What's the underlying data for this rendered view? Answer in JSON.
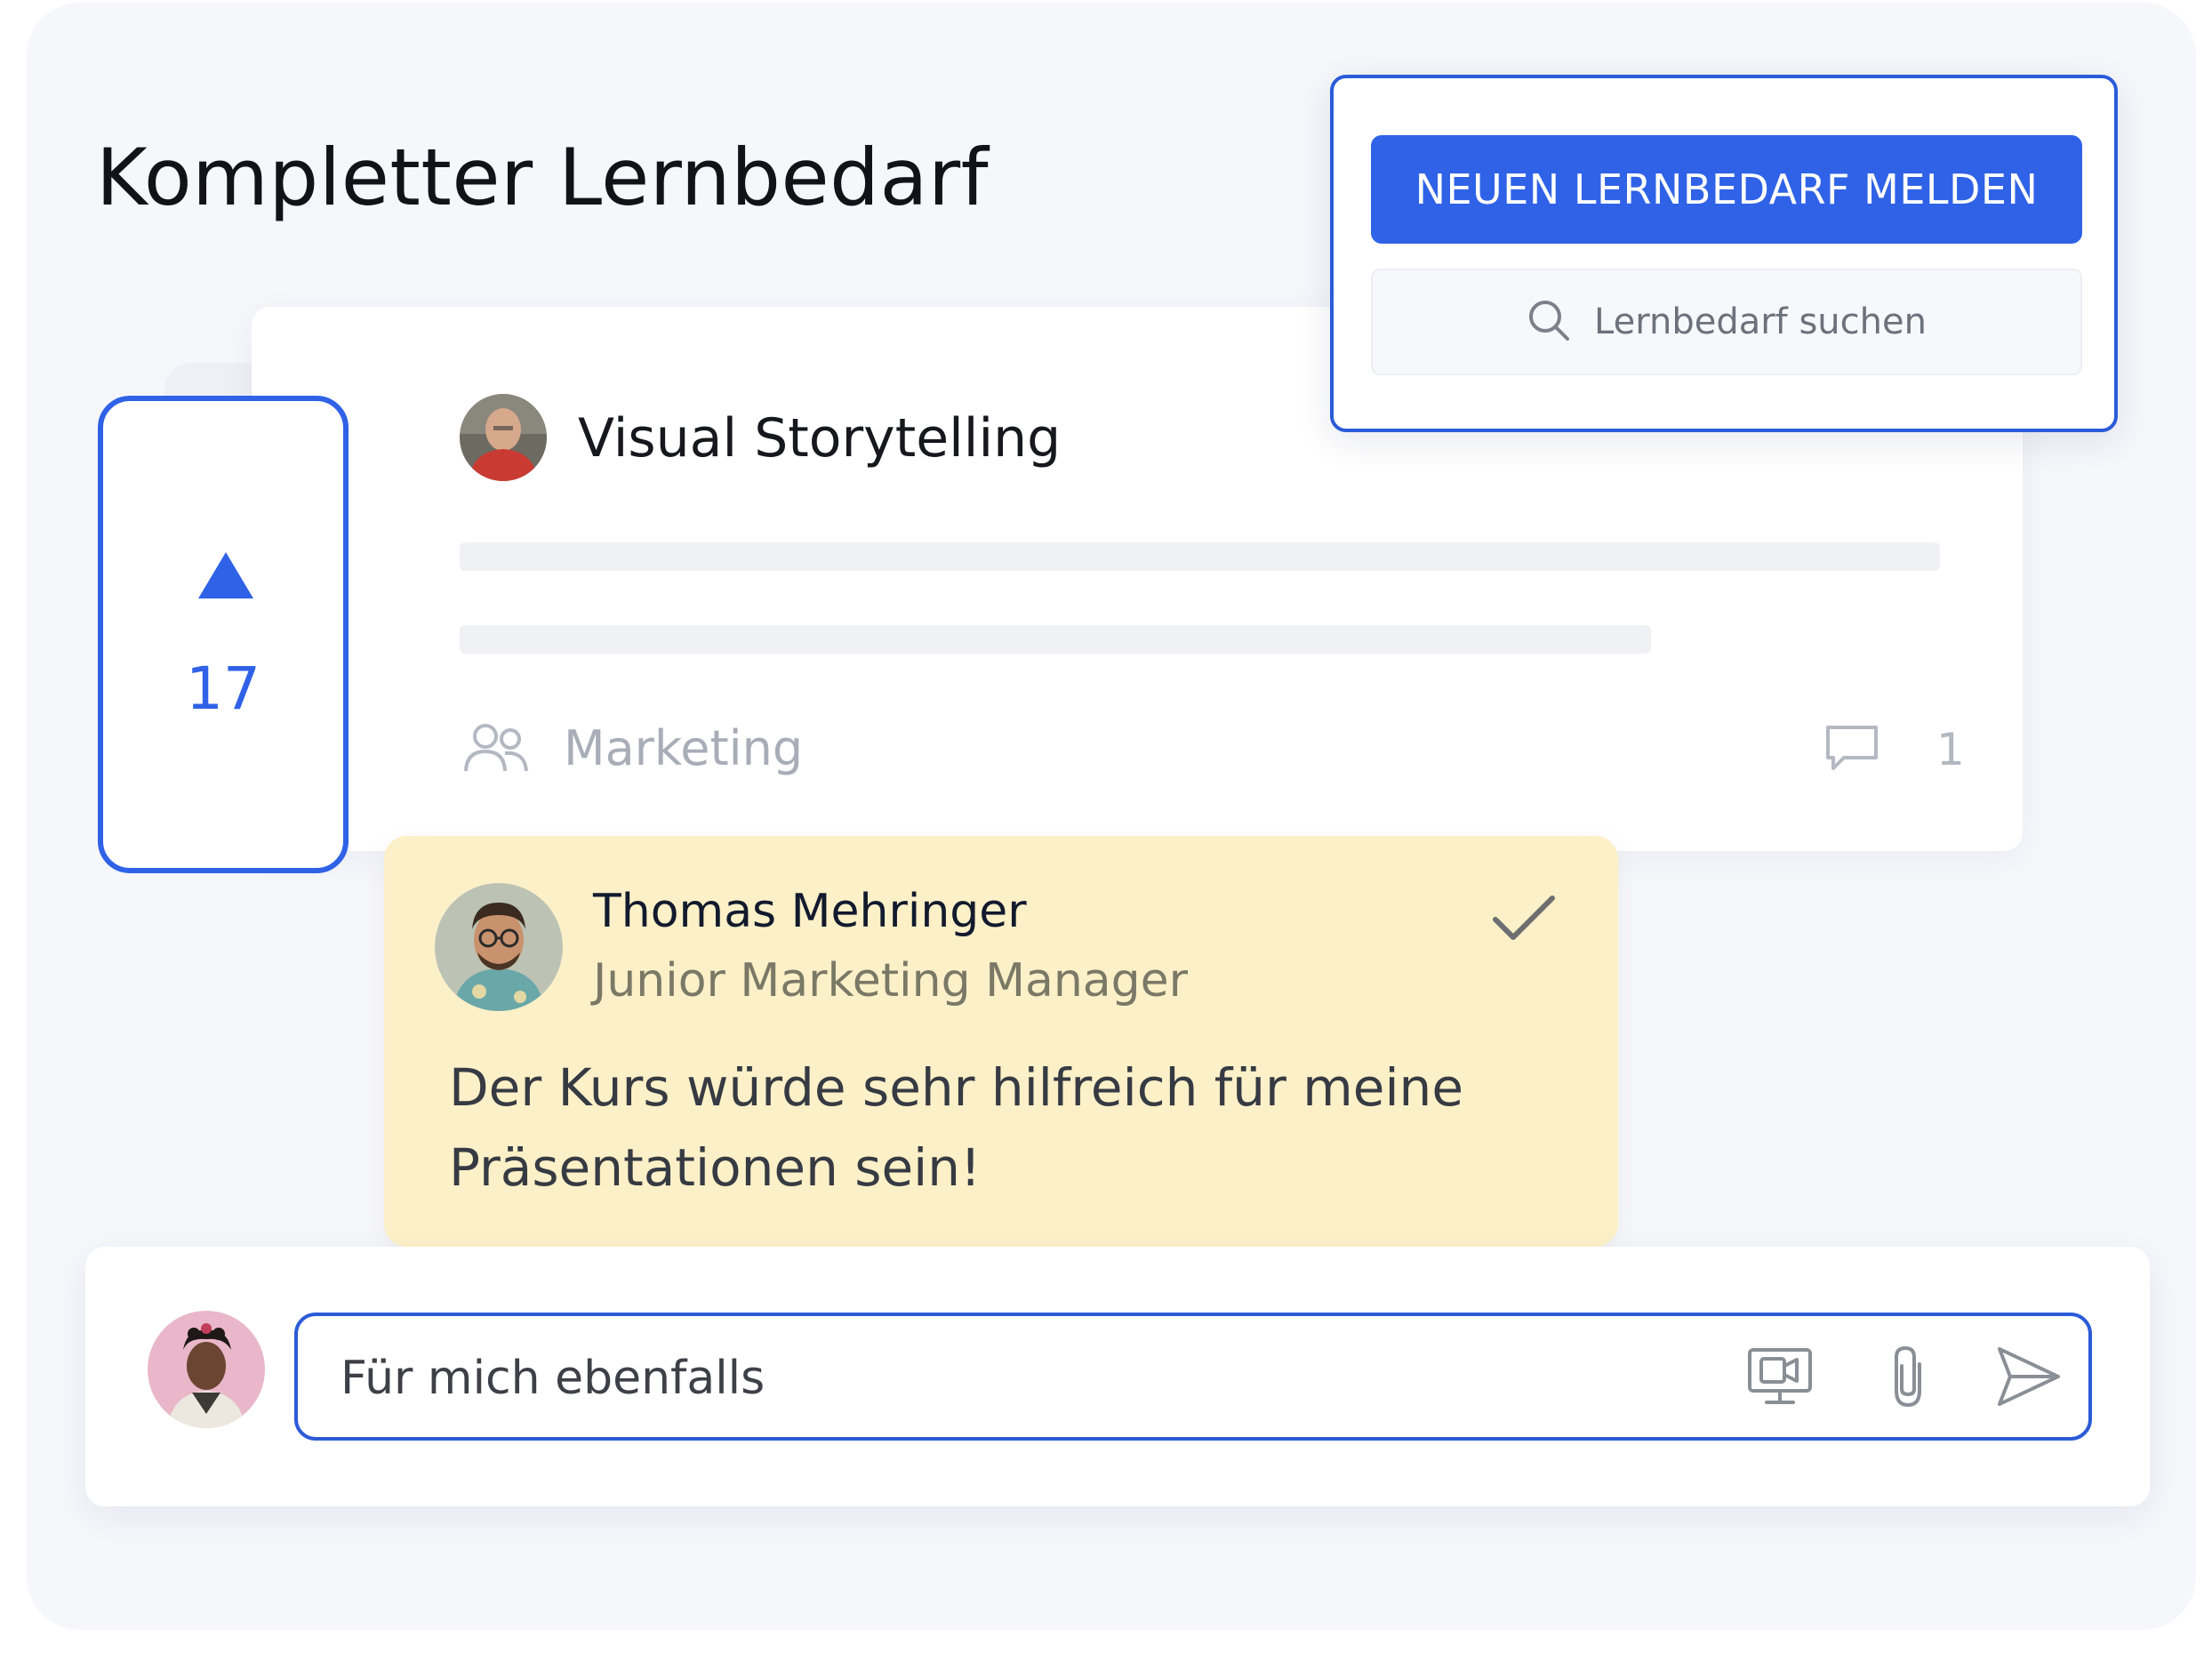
{
  "page": {
    "title": "Kompletter Lernbedarf"
  },
  "actions": {
    "new_request_label": "NEUEN LERNBEDARF MELDEN",
    "search_placeholder": "Lernbedarf suchen"
  },
  "request": {
    "title": "Visual Storytelling",
    "votes": "17",
    "team": "Marketing",
    "comment_count": "1"
  },
  "comment": {
    "author_name": "Thomas Mehringer",
    "author_role": "Junior Marketing Manager",
    "text": "Der Kurs würde sehr hilfreich für meine Präsentationen sein!"
  },
  "composer": {
    "value": "Für mich ebenfalls"
  },
  "colors": {
    "accent": "#2f62e6",
    "comment_bg": "#fcf0c8"
  },
  "icons": [
    "search-icon",
    "upvote-arrow-icon",
    "team-icon",
    "comment-icon",
    "checkmark-icon",
    "screen-record-icon",
    "paperclip-icon",
    "send-icon"
  ]
}
